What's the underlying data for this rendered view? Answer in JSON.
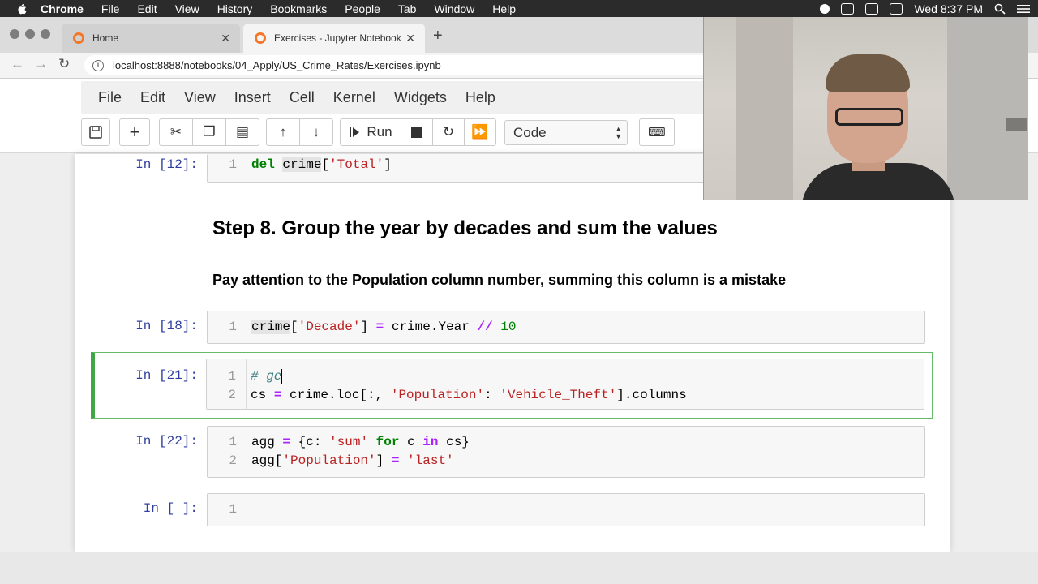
{
  "menubar": {
    "app": "Chrome",
    "items": [
      "File",
      "Edit",
      "View",
      "History",
      "Bookmarks",
      "People",
      "Tab",
      "Window",
      "Help"
    ],
    "clock": "Wed 8:37 PM"
  },
  "tabs": [
    {
      "title": "Home"
    },
    {
      "title": "Exercises - Jupyter Notebook"
    }
  ],
  "address": {
    "url": "localhost:8888/notebooks/04_Apply/US_Crime_Rates/Exercises.ipynb"
  },
  "jupyter": {
    "menu": [
      "File",
      "Edit",
      "View",
      "Insert",
      "Cell",
      "Kernel",
      "Widgets",
      "Help"
    ],
    "toolbar": {
      "run_label": "Run",
      "celltype_value": "Code"
    }
  },
  "notebook": {
    "cells": [
      {
        "prompt": "In [12]:",
        "lines": [
          {
            "n": "1"
          }
        ]
      },
      {
        "prompt": "In [18]:",
        "lines": [
          {
            "n": "1"
          }
        ]
      },
      {
        "prompt": "In [21]:",
        "lines": [
          {
            "n": "1"
          },
          {
            "n": "2"
          }
        ]
      },
      {
        "prompt": "In [22]:",
        "lines": [
          {
            "n": "1"
          },
          {
            "n": "2"
          }
        ]
      },
      {
        "prompt": "In [ ]:",
        "lines": [
          {
            "n": "1"
          }
        ]
      }
    ],
    "heading": "Step 8. Group the year by decades and sum the values",
    "subheading": "Pay attention to the Population column number, summing this column is a mistake",
    "code": {
      "c12_l1": [
        "del",
        " ",
        "crime",
        "[",
        "'Total'",
        "]"
      ],
      "c18_l1": [
        "crime",
        "[",
        "'Decade'",
        "] ",
        "=",
        " crime.Year ",
        "//",
        " ",
        "10"
      ],
      "c21_l1": [
        "# ge"
      ],
      "c21_l2": [
        "cs ",
        "=",
        " crime.loc[:, ",
        "'Population'",
        ": ",
        "'Vehicle_Theft'",
        "].columns"
      ],
      "c22_l1": [
        "agg ",
        "=",
        " {c: ",
        "'sum'",
        " ",
        "for",
        " c ",
        "in",
        " cs}"
      ],
      "c22_l2": [
        "agg[",
        "'Population'",
        "] ",
        "=",
        " ",
        "'last'"
      ]
    }
  }
}
